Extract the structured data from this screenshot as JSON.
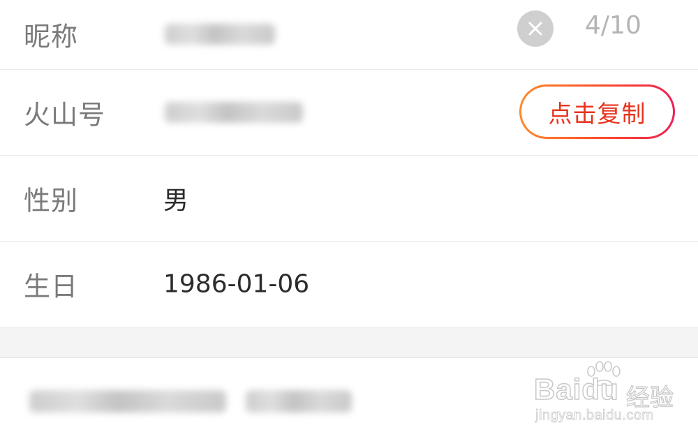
{
  "profile": {
    "nickname": {
      "label": "昵称",
      "counter": "4/10"
    },
    "huoshan_id": {
      "label": "火山号",
      "copy_label": "点击复制"
    },
    "gender": {
      "label": "性别",
      "value": "男"
    },
    "birthday": {
      "label": "生日",
      "value": "1986-01-06"
    }
  },
  "icons": {
    "clear": "close-circle-icon"
  },
  "colors": {
    "label": "#7a7a7a",
    "value": "#2b2b2b",
    "counter": "#b4b4b4",
    "copy_text": "#e8341e",
    "copy_gradient_start": "#ff8a2a",
    "copy_gradient_end": "#ef1f55",
    "clear_bg": "#cfcfcf"
  },
  "watermark": {
    "logo": "Baidu",
    "product": "经验",
    "url": "jingyan.baidu.com"
  }
}
